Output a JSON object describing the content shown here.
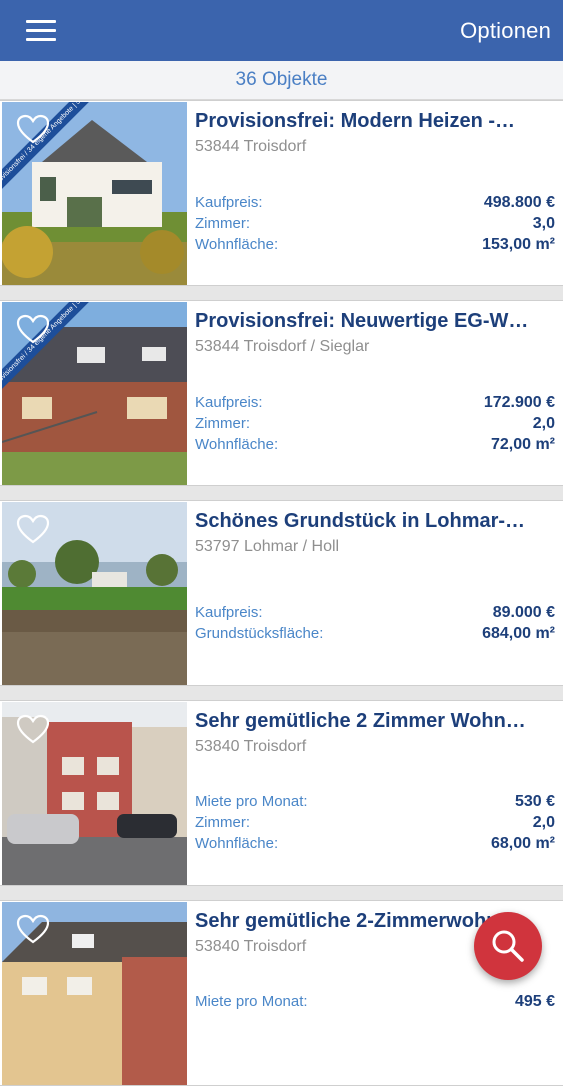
{
  "header": {
    "options_label": "Optionen"
  },
  "count_label": "36 Objekte",
  "listings": [
    {
      "title": "Provisionsfrei: Modern Heizen -…",
      "location": "53844 Troisdorf",
      "badge": "provisionsfrei / 34 eigene Angebote | 5326",
      "rows": [
        {
          "label": "Kaufpreis:",
          "value": "498.800 €"
        },
        {
          "label": "Zimmer:",
          "value": "3,0"
        },
        {
          "label": "Wohnfläche:",
          "value": "153,00 m²"
        }
      ]
    },
    {
      "title": "Provisionsfrei: Neuwertige EG-W…",
      "location": "53844 Troisdorf / Sieglar",
      "badge": "provisionsfrei / 34 eigene Angebote | 5327",
      "rows": [
        {
          "label": "Kaufpreis:",
          "value": "172.900 €"
        },
        {
          "label": "Zimmer:",
          "value": "2,0"
        },
        {
          "label": "Wohnfläche:",
          "value": "72,00 m²"
        }
      ]
    },
    {
      "title": "Schönes Grundstück in Lohmar-…",
      "location": "53797 Lohmar / Holl",
      "rows": [
        {
          "label": "Kaufpreis:",
          "value": "89.000 €"
        },
        {
          "label": "Grundstücksfläche:",
          "value": "684,00 m²"
        }
      ]
    },
    {
      "title": "Sehr gemütliche 2 Zimmer Wohn…",
      "location": "53840 Troisdorf",
      "rows": [
        {
          "label": "Miete pro Monat:",
          "value": "530 €"
        },
        {
          "label": "Zimmer:",
          "value": "2,0"
        },
        {
          "label": "Wohnfläche:",
          "value": "68,00 m²"
        }
      ]
    },
    {
      "title": "Sehr gemütliche 2-Zimmerwohn…",
      "location": "53840 Troisdorf",
      "rows": [
        {
          "label": "Miete pro Monat:",
          "value": "495 €"
        }
      ]
    }
  ],
  "colors": {
    "header_bg": "#3b64ad",
    "title_text": "#1d3f7a",
    "label_text": "#4a86c8",
    "fab_bg": "#d0343d"
  },
  "icons": {
    "menu": "hamburger-icon",
    "favorite": "heart-outline-icon",
    "search": "magnifier-icon"
  }
}
